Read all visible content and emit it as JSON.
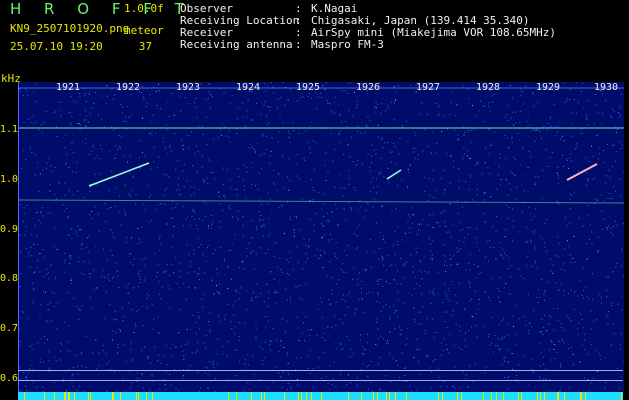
{
  "header": {
    "app_title": "H R O F F T",
    "version": "1.0.0f",
    "filename": "KN9_2507101920.png",
    "mode": "meteor",
    "datetime": "25.07.10 19:20",
    "count": "37",
    "info": [
      {
        "label": "Observer",
        "value": "K.Nagai"
      },
      {
        "label": "Receiving Location",
        "value": "Chigasaki, Japan (139.414 35.340)"
      },
      {
        "label": "Receiver",
        "value": "AirSpy mini (Miakejima VOR 108.65MHz)"
      },
      {
        "label": "Receiving antenna",
        "value": "Maspro FM-3"
      }
    ]
  },
  "spectrogram": {
    "y_unit": "kHz",
    "y_ticks": [
      "1.1",
      "1.0",
      "0.9",
      "0.8",
      "0.7",
      "0.6"
    ],
    "x_ticks": [
      "1921",
      "1922",
      "1923",
      "1924",
      "1925",
      "1926",
      "1927",
      "1928",
      "1929",
      "1930"
    ]
  },
  "colors": {
    "background": "#000c6a",
    "noise": "#3b5cff",
    "signal": "#9fffe0",
    "label": "#e8e800"
  }
}
